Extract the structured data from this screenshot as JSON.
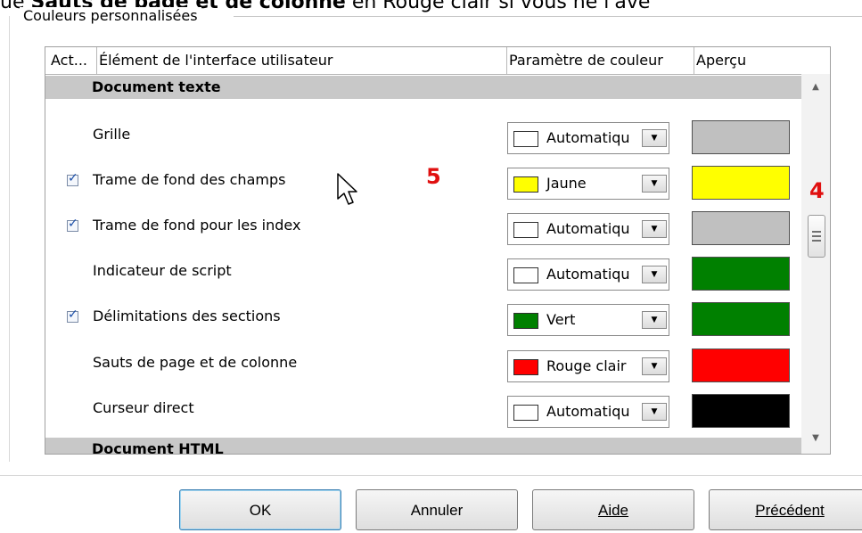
{
  "top_text": {
    "prefix": "ue ",
    "bold": "Sauts de page et de colonne",
    "suffix": " en Rouge clair si vous ne l'ave"
  },
  "group": {
    "legend": "Couleurs personnalisées"
  },
  "table": {
    "headers": [
      "Act...",
      "Élément de l'interface utilisateur",
      "Paramètre de couleur",
      "Aperçu"
    ],
    "section_top": "Document texte",
    "section_bottom": "Document HTML",
    "rows": [
      {
        "label": "Grille",
        "checked": false,
        "color_name": "Automatiqu",
        "swatch": "#ffffff",
        "preview": "#c0c0c0"
      },
      {
        "label": "Trame de fond des champs",
        "checked": true,
        "color_name": "Jaune",
        "swatch": "#ffff00",
        "preview": "#ffff00"
      },
      {
        "label": "Trame de fond pour les index",
        "checked": true,
        "color_name": "Automatiqu",
        "swatch": "#ffffff",
        "preview": "#c0c0c0"
      },
      {
        "label": "Indicateur de script",
        "checked": false,
        "color_name": "Automatiqu",
        "swatch": "#ffffff",
        "preview": "#008000"
      },
      {
        "label": "Délimitations des sections",
        "checked": true,
        "color_name": "Vert",
        "swatch": "#008000",
        "preview": "#008000"
      },
      {
        "label": "Sauts de page et de colonne",
        "checked": false,
        "color_name": "Rouge clair",
        "swatch": "#ff0000",
        "preview": "#ff0000"
      },
      {
        "label": "Curseur direct",
        "checked": false,
        "color_name": "Automatiqu",
        "swatch": "#ffffff",
        "preview": "#000000"
      }
    ]
  },
  "markers": {
    "five": "5",
    "four": "4",
    "color": "#e01010"
  },
  "buttons": {
    "ok": "OK",
    "cancel": "Annuler",
    "help": "Aide",
    "previous": "Précédent"
  }
}
